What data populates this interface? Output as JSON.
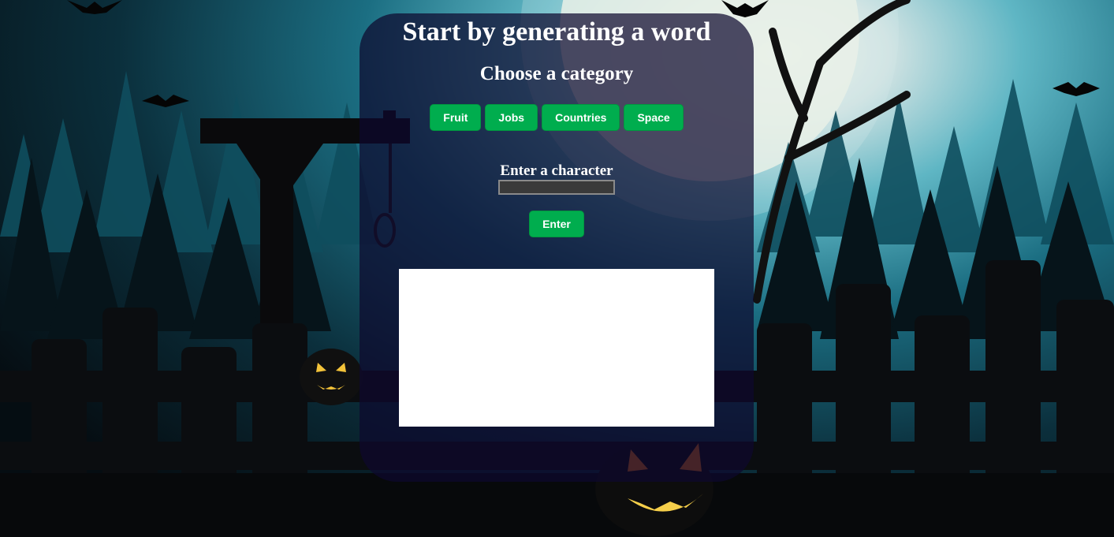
{
  "title": "Start by generating a word",
  "category_heading": "Choose a category",
  "categories": [
    {
      "label": "Fruit"
    },
    {
      "label": "Jobs"
    },
    {
      "label": "Countries"
    },
    {
      "label": "Space"
    }
  ],
  "guess": {
    "label": "Enter a character",
    "value": "",
    "submit_label": "Enter"
  },
  "colors": {
    "button": "#00ad4e",
    "panel": "#0e082e",
    "text": "#ffffff",
    "drawing_area": "#ffffff"
  },
  "background": {
    "icons": [
      "moon-icon",
      "gallows-icon",
      "pumpkin-icon",
      "bat-icon",
      "tree-icon",
      "fence-icon"
    ]
  }
}
